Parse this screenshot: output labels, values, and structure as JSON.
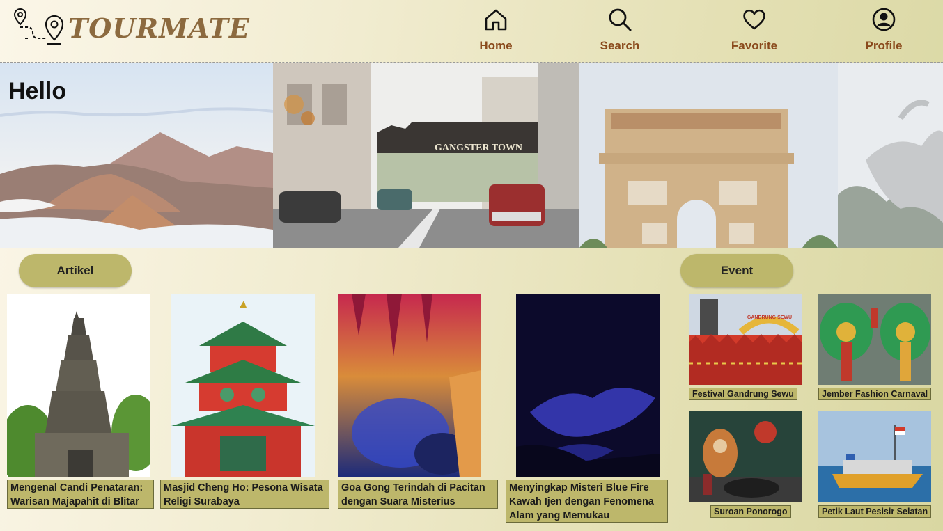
{
  "app": {
    "logo_text": "TOURMATE"
  },
  "nav": [
    {
      "label": "Home",
      "icon": "home-icon"
    },
    {
      "label": "Search",
      "icon": "search-icon"
    },
    {
      "label": "Favorite",
      "icon": "heart-icon"
    },
    {
      "label": "Profile",
      "icon": "user-circle-icon"
    }
  ],
  "hero": {
    "title": "Hello",
    "sign_text": "GANGSTER TOWN"
  },
  "sections": {
    "articles_label": "Artikel",
    "events_label": "Event"
  },
  "articles": [
    {
      "title": "Mengenal Candi Penataran: Warisan Majapahit di Blitar"
    },
    {
      "title": "Masjid Cheng Ho: Pesona Wisata Religi Surabaya"
    },
    {
      "title": "Goa Gong Terindah di Pacitan dengan Suara Misterius"
    },
    {
      "title": "Menyingkap Misteri Blue Fire Kawah Ijen dengan Fenomena Alam yang Memukau"
    }
  ],
  "events": [
    {
      "title": "Festival Gandrung Sewu",
      "banner": "GANDRUNG SEWU"
    },
    {
      "title": "Jember Fashion Carnaval"
    },
    {
      "title": "Suroan Ponorogo"
    },
    {
      "title": "Petik Laut Pesisir Selatan"
    }
  ],
  "colors": {
    "accent": "#bdb76b",
    "nav_text": "#8a4a1c",
    "logo": "#8c6a3f"
  }
}
